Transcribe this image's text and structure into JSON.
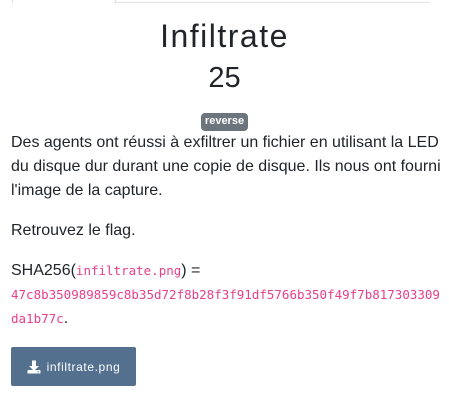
{
  "challenge": {
    "title": "Infiltrate",
    "points": "25",
    "category": "reverse",
    "description": "Des agents ont réussi à exfiltrer un fichier en utilisant la LED du disque dur durant une copie de disque. Ils nous ont fourni l'image de la capture.",
    "instruction": "Retrouvez le flag.",
    "sha_prefix": "SHA256(",
    "sha_file": "infiltrate.png",
    "sha_mid": ") =",
    "sha_hash": "47c8b350989859c8b35d72f8b28f3f91df5766b350f49f7b817303309da1b77c",
    "sha_end": "."
  },
  "download": {
    "label": "infiltrate.png",
    "icon": "download-icon"
  },
  "colors": {
    "button_bg": "#53718f",
    "code": "#e83e8c",
    "badge": "#6c757d"
  }
}
